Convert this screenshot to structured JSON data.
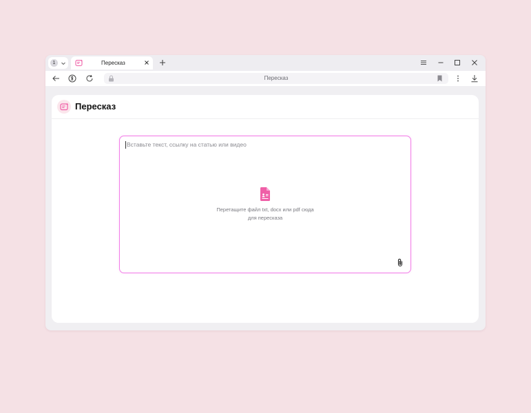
{
  "browser": {
    "tab_count": "1",
    "active_tab_title": "Пересказ",
    "address_bar_text": "Пересказ"
  },
  "page": {
    "title": "Пересказ",
    "input_placeholder": "Вставьте текст, ссылку на статью или видео",
    "drop_hint_line1": "Перетащите файл txt, docx или pdf сюда",
    "drop_hint_line2": "для пересказа"
  },
  "colors": {
    "accent": "#ef5fa7",
    "box_border": "#f27ee8",
    "background": "#f5e1e5"
  },
  "icons": [
    "chevron-down-icon",
    "summary-icon",
    "close-icon",
    "plus-icon",
    "menu-icon",
    "minimize-icon",
    "maximize-icon",
    "back-arrow-icon",
    "yandex-icon",
    "reload-icon",
    "lock-icon",
    "bookmark-icon",
    "more-vertical-icon",
    "download-icon",
    "file-icon",
    "paperclip-icon"
  ]
}
